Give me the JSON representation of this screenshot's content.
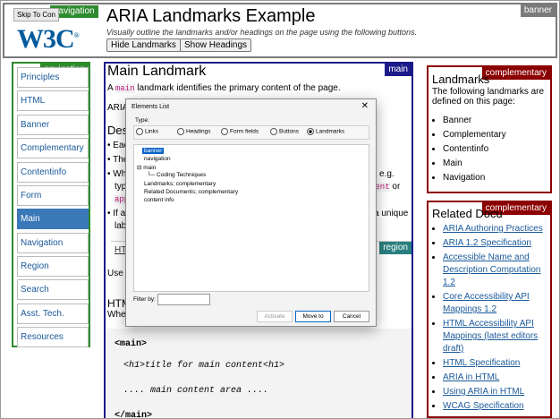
{
  "banner": {
    "landmark_tag": "banner",
    "nav_tag": "navigation",
    "skip_link": "Skip To Con",
    "logo_text": "W3C",
    "logo_reg": "®",
    "title": "ARIA Landmarks Example",
    "subtitle": "Visually outline the landmarks and/or headings on the page using the following buttons.",
    "btn_hide_landmarks": "Hide Landmarks",
    "btn_show_headings": "Show Headings"
  },
  "leftnav": {
    "tag": "navigation",
    "items": [
      "Principles",
      "HTML",
      "Banner",
      "Complementary",
      "Contentinfo",
      "Form",
      "Main",
      "Navigation",
      "Region",
      "Search",
      "Asst. Tech.",
      "Resources"
    ],
    "active_index": 6
  },
  "main": {
    "tag": "main",
    "heading": "Main Landmark",
    "intro_a": "A",
    "intro_code": "main",
    "intro_b": "landmark identifies the primary content of the page.",
    "aria_trunc": "ARIA",
    "desc_trunc": "Desi",
    "b1": "Eac",
    "b2": "The",
    "b3": "Wh",
    "b3_end": "e.g.",
    "b3b": "typi",
    "b3b_code": "ment",
    "b3b_or": "or",
    "b3c_code": "app",
    "b4": "If a",
    "b4_end": "a unique",
    "b4b": "labe",
    "region_tag": "region",
    "region_tab": "HTM",
    "use_trunc": "Use t",
    "html_trunc": "HTM",
    "when_trunc": "When",
    "code_lines": [
      "<main>",
      "<h1>title for main content<h1>",
      ".... main content area ....",
      "</main>"
    ]
  },
  "right1": {
    "tag": "complementary",
    "heading": "Landmarks",
    "desc": "The following landmarks are defined on this page:",
    "items": [
      "Banner",
      "Complementary",
      "Contentinfo",
      "Main",
      "Navigation"
    ]
  },
  "right2": {
    "tag": "complementary",
    "heading": "Related Docu",
    "links": [
      "ARIA Authoring Practices",
      "ARIA 1.2 Specification",
      "Accessible Name and Description Computation 1.2",
      "Core Accessibility API Mappings 1.2",
      "HTML Accessibility API Mappings (latest editors draft)",
      "HTML Specification",
      "ARIA in HTML",
      "Using ARIA in HTML",
      "WCAG Specification"
    ]
  },
  "dialog": {
    "title": "Elements List",
    "close": "✕",
    "type_label": "Type:",
    "radios": [
      "Links",
      "Headings",
      "Form fields",
      "Buttons",
      "Landmarks"
    ],
    "selected_radio": "Landmarks",
    "tree": [
      {
        "label": "banner",
        "level": 0,
        "selected": true
      },
      {
        "label": "navigation",
        "level": 0
      },
      {
        "label": "main",
        "level": 0,
        "expanded": true
      },
      {
        "label": "Coding Techniques",
        "level": 1
      },
      {
        "label": "Landmarks; complementary",
        "level": 0
      },
      {
        "label": "Related Documents; complementary",
        "level": 0
      },
      {
        "label": "content info",
        "level": 0
      }
    ],
    "filter_label": "Filter by:",
    "filter_value": "",
    "btn_activate": "Activate",
    "btn_move": "Move to",
    "btn_cancel": "Cancel"
  },
  "colors": {
    "banner_border": "#7a7a7a",
    "nav_green": "#2e8b2e",
    "main_navy": "#1a1a8a",
    "complementary_maroon": "#8b0000",
    "region_teal": "#2a7f7f",
    "link_blue": "#1a5a9a",
    "active_blue": "#3a78b8"
  }
}
